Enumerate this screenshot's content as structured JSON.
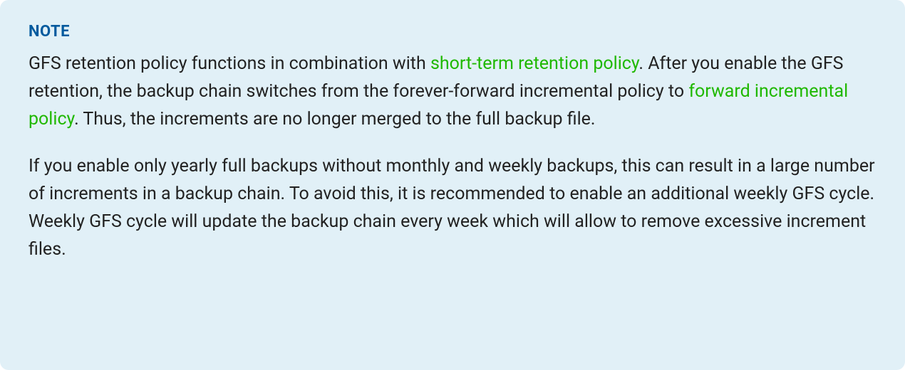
{
  "note": {
    "heading": "NOTE",
    "p1": {
      "t1": "GFS retention policy functions in combination with ",
      "link1": "short-term retention policy",
      "t2": ". After you enable the GFS retention, the backup chain switches from the forever-forward incremental policy to ",
      "link2": "forward incremental policy",
      "t3": ". Thus, the increments are no longer merged to the full backup file."
    },
    "p2": "If you enable only yearly full backups without monthly and weekly backups, this can result in a large number of increments in a backup chain. To avoid this, it is recommended to enable an additional weekly GFS cycle. Weekly GFS cycle will update the backup chain every week which will allow to remove excessive increment files."
  }
}
